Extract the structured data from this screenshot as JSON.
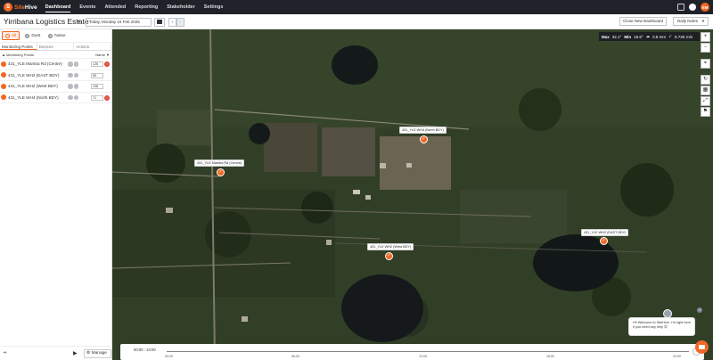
{
  "brand": {
    "name_a": "Site",
    "name_b": "Hive"
  },
  "nav": {
    "items": [
      "Dashboard",
      "Events",
      "Attended",
      "Reporting",
      "Stakeholder",
      "Settings"
    ],
    "avatar_initials": "EM"
  },
  "titlebar": {
    "title": "Yirribana Logistics Estate",
    "date": "Today, Monday 24 Feb 2025",
    "prev": "‹",
    "next": "›",
    "close_dashboard": "Close New Dashboard",
    "daily_notes": "Daily Notes"
  },
  "filters": [
    {
      "label": "All",
      "active": true
    },
    {
      "label": "Dust",
      "active": false
    },
    {
      "label": "Noise",
      "active": false
    }
  ],
  "tabs": [
    "Monitoring Points",
    "Devices",
    "Actions"
  ],
  "list_header": {
    "left": "▲ Monitoring Points",
    "right": "Name ▼"
  },
  "points": [
    {
      "name": "431_YLE Mamba Rd (Centre)",
      "count": "126",
      "alert": "!"
    },
    {
      "name": "431_YLE WH2 (EAST BDY)",
      "count": "80",
      "alert": ""
    },
    {
      "name": "431_YLE WH2 (West BDY)",
      "count": "136",
      "alert": ""
    },
    {
      "name": "431_YLE WH4 (North BDY)",
      "count": "71",
      "alert": "!"
    }
  ],
  "panel_bottom": {
    "manage": "Manage"
  },
  "map_labels": [
    {
      "text": "431_YLE WH4 (North BDY)"
    },
    {
      "text": "431_YLE Mamba Rd (Centre)"
    },
    {
      "text": "431_YLE WH2 (EAST BDY)"
    },
    {
      "text": "431_YLE WH2 (West BDY)"
    }
  ],
  "weather": {
    "max_label": "Max",
    "max_val": "32.1°",
    "min_label": "Min",
    "min_val": "19.6°",
    "rain": "0.8 mm",
    "wind": "8.73K m/s"
  },
  "timeline": {
    "range": "00:00 - 24:00",
    "ticks": [
      "00:00",
      "06:00",
      "12:00",
      "18:00",
      "24:00"
    ]
  },
  "chat": {
    "message": "Hi! Welcome to SiteHive. I'm right here if you need any help 😊",
    "close": "×"
  },
  "colors": {
    "accent": "#f26722",
    "nav_bg": "#1f2329",
    "alert": "#e0483c"
  }
}
